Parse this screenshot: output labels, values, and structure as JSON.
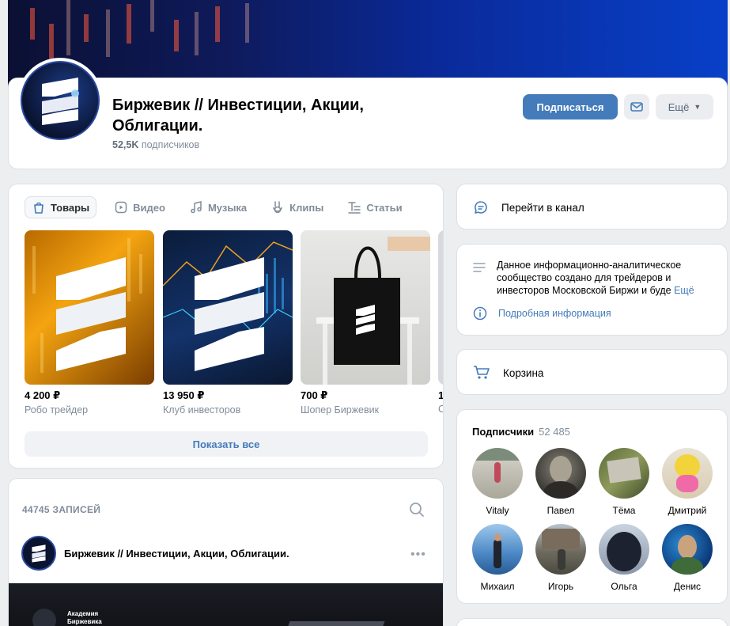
{
  "header": {
    "title": "Биржевик // Инвестиции, Акции, Облигации.",
    "subscribers_count": "52,5K",
    "subscribers_label": "подписчиков",
    "subscribe_label": "Подписаться",
    "more_label": "Ещё"
  },
  "products": {
    "tabs": [
      {
        "label": "Товары",
        "icon": "bag-icon",
        "active": true
      },
      {
        "label": "Видео",
        "icon": "video-icon"
      },
      {
        "label": "Музыка",
        "icon": "music-icon"
      },
      {
        "label": "Клипы",
        "icon": "clips-icon"
      },
      {
        "label": "Статьи",
        "icon": "articles-icon"
      }
    ],
    "items": [
      {
        "price": "4 200 ₽",
        "name": "Робо трейдер"
      },
      {
        "price": "13 950 ₽",
        "name": "Клуб инвесторов"
      },
      {
        "price": "700 ₽",
        "name": "Шопер Биржевик"
      },
      {
        "price": "1",
        "name": "С"
      }
    ],
    "show_all_label": "Показать все"
  },
  "wall": {
    "records_label": "44745 ЗАПИСЕЙ",
    "post_author": "Биржевик // Инвестиции, Акции, Облигации.",
    "post_image_text_1": "Академия",
    "post_image_text_2": "Биржевика"
  },
  "sidebar": {
    "channel_label": "Перейти в канал",
    "about_text": "Данное информационно-аналитическое сообщество создано для трейдеров и инвесторов Московской Биржи и буде",
    "about_more": "Ещё",
    "info_label": "Подробная информация",
    "cart_label": "Корзина",
    "followers_title": "Подписчики",
    "followers_count": "52 485",
    "followers": [
      {
        "name": "Vitaly"
      },
      {
        "name": "Павел"
      },
      {
        "name": "Тёма"
      },
      {
        "name": "Дмитрий"
      },
      {
        "name": "Михаил"
      },
      {
        "name": "Игорь"
      },
      {
        "name": "Ольга"
      },
      {
        "name": "Денис"
      }
    ]
  },
  "colors": {
    "accent": "#447bba",
    "muted": "#818c99",
    "background": "#edeef0"
  }
}
